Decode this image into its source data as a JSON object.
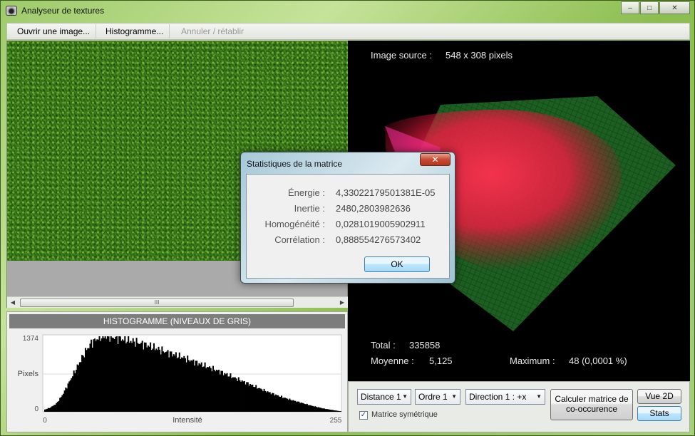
{
  "window": {
    "title": "Analyseur de textures",
    "controls": {
      "minimize": "–",
      "maximize": "□",
      "close": "✕"
    }
  },
  "toolbar": {
    "open_label": "Ouvrir une image...",
    "histogram_label": "Histogramme...",
    "undo_label": "Annuler / rétablir"
  },
  "scrollbar": {
    "grip": "III",
    "left_arrow": "◀",
    "right_arrow": "▶"
  },
  "histogram": {
    "header": "HISTOGRAMME (NIVEAUX DE GRIS)",
    "ylabel": "Pixels",
    "xlabel": "Intensité",
    "y_max_label": "1374",
    "y_min_label": "0",
    "x_min_label": "0",
    "x_max_label": "255"
  },
  "chart_data": {
    "type": "bar",
    "xlabel": "Intensité",
    "ylabel": "Pixels",
    "xlim": [
      0,
      255
    ],
    "ylim": [
      0,
      1374
    ],
    "shape_points": [
      [
        0,
        40
      ],
      [
        5,
        80
      ],
      [
        10,
        150
      ],
      [
        15,
        300
      ],
      [
        20,
        500
      ],
      [
        25,
        700
      ],
      [
        30,
        900
      ],
      [
        35,
        1100
      ],
      [
        40,
        1250
      ],
      [
        45,
        1330
      ],
      [
        50,
        1374
      ],
      [
        55,
        1370
      ],
      [
        60,
        1350
      ],
      [
        70,
        1310
      ],
      [
        80,
        1260
      ],
      [
        90,
        1200
      ],
      [
        100,
        1120
      ],
      [
        110,
        1050
      ],
      [
        120,
        980
      ],
      [
        130,
        900
      ],
      [
        140,
        820
      ],
      [
        150,
        740
      ],
      [
        160,
        650
      ],
      [
        170,
        560
      ],
      [
        180,
        470
      ],
      [
        190,
        380
      ],
      [
        200,
        300
      ],
      [
        210,
        230
      ],
      [
        220,
        170
      ],
      [
        230,
        110
      ],
      [
        240,
        60
      ],
      [
        250,
        25
      ],
      [
        255,
        10
      ]
    ]
  },
  "view3d": {
    "source_label": "Image source :",
    "source_value": "548 x 308 pixels",
    "total_label": "Total :",
    "total_value": "335858",
    "mean_label": "Moyenne :",
    "mean_value": "5,125",
    "max_label": "Maximum :",
    "max_value": "48 (0,0001 %)"
  },
  "controls": {
    "distance": "Distance 1",
    "order": "Ordre 1",
    "direction": "Direction 1 : +x",
    "symmetric_checked": true,
    "symmetric_label": "Matrice symétrique",
    "compute_label_line1": "Calculer matrice de",
    "compute_label_line2": "co-occurence",
    "view2d_label": "Vue 2D",
    "stats_label": "Stats",
    "caret": "▼",
    "check_mark": "✓"
  },
  "dialog": {
    "title": "Statistiques de la matrice",
    "close": "✕",
    "stats": [
      {
        "label": "Énergie :",
        "value": "4,33022179501381E-05"
      },
      {
        "label": "Inertie :",
        "value": "2480,2803982636"
      },
      {
        "label": "Homogénéité :",
        "value": "0,0281019005902911"
      },
      {
        "label": "Corrélation :",
        "value": "0,888554276573402"
      }
    ],
    "ok_label": "OK"
  }
}
